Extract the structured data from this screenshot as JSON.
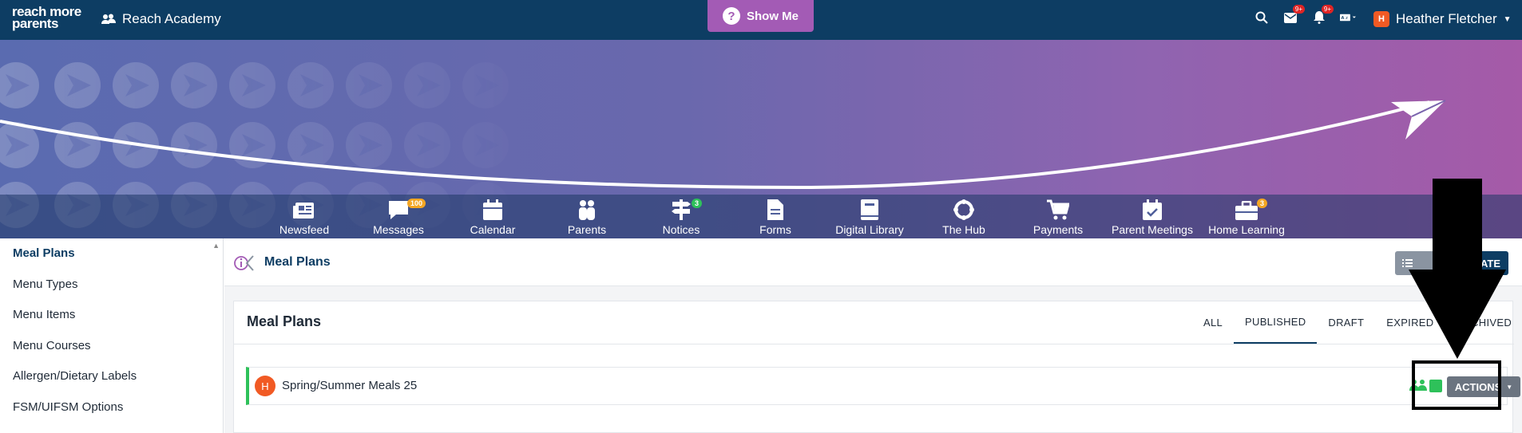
{
  "topbar": {
    "logo_line1": "reach more",
    "logo_line2": "parents",
    "school_name": "Reach Academy",
    "show_me_label": "Show Me",
    "mail_badge": "9+",
    "bell_badge": "9+",
    "user_initial": "H",
    "user_name": "Heather Fletcher"
  },
  "nav": [
    {
      "label": "Newsfeed",
      "icon": "newspaper-icon"
    },
    {
      "label": "Messages",
      "icon": "chat-icon",
      "badge": "100"
    },
    {
      "label": "Calendar",
      "icon": "calendar-icon"
    },
    {
      "label": "Parents",
      "icon": "people-icon"
    },
    {
      "label": "Notices",
      "icon": "signpost-icon",
      "badge": "3"
    },
    {
      "label": "Forms",
      "icon": "document-icon"
    },
    {
      "label": "Digital Library",
      "icon": "book-icon"
    },
    {
      "label": "The Hub",
      "icon": "hub-icon"
    },
    {
      "label": "Payments",
      "icon": "cart-icon"
    },
    {
      "label": "Parent Meetings",
      "icon": "calendar-check-icon"
    },
    {
      "label": "Home Learning",
      "icon": "briefcase-icon",
      "badge": "3"
    }
  ],
  "sidebar": {
    "items": [
      {
        "label": "Meal Plans"
      },
      {
        "label": "Menu Types"
      },
      {
        "label": "Menu Items"
      },
      {
        "label": "Menu Courses"
      },
      {
        "label": "Allergen/Dietary Labels"
      },
      {
        "label": "FSM/UIFSM Options"
      }
    ]
  },
  "header": {
    "title": "Meal Plans",
    "create_label": "CREATE"
  },
  "card": {
    "title": "Meal Plans",
    "tabs": [
      "ALL",
      "PUBLISHED",
      "DRAFT",
      "EXPIRED",
      "ARCHIVED"
    ],
    "active_tab": "PUBLISHED"
  },
  "rows": [
    {
      "initial": "H",
      "name": "Spring/Summer Meals 25",
      "actions_label": "ACTIONS"
    }
  ],
  "colors": {
    "navy": "#0d3d63",
    "purple": "#a35bb5",
    "green": "#2ec15a",
    "orange": "#f15a24"
  }
}
